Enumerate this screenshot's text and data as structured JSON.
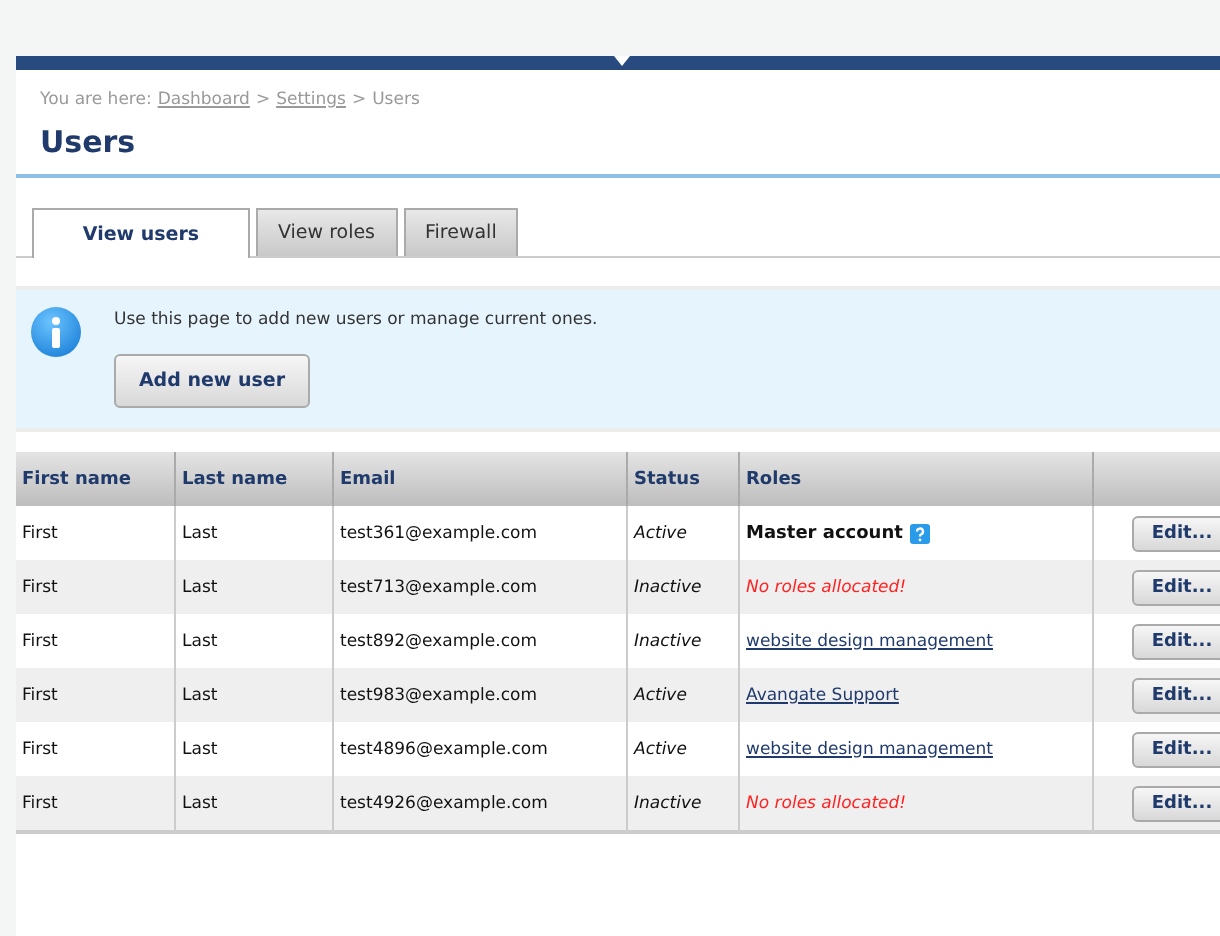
{
  "breadcrumb": {
    "prefix": "You are here:",
    "links": [
      "Dashboard",
      "Settings"
    ],
    "separator": ">",
    "current": "Users"
  },
  "title": "Users",
  "tabs": [
    {
      "label": "View users",
      "selected": true
    },
    {
      "label": "View roles",
      "selected": false
    },
    {
      "label": "Firewall",
      "selected": false
    }
  ],
  "info": {
    "message": "Use this page to add new users or manage current ones.",
    "button": "Add new user"
  },
  "table": {
    "columns": [
      "First name",
      "Last name",
      "Email",
      "Status",
      "Roles"
    ],
    "rows": [
      {
        "first": "First",
        "last": "Last",
        "email": "test361@example.com",
        "status": "Active",
        "role": {
          "kind": "master",
          "text": "Master account"
        },
        "action": "Edit..."
      },
      {
        "first": "First",
        "last": "Last",
        "email": "test713@example.com",
        "status": "Inactive",
        "role": {
          "kind": "none",
          "text": "No roles allocated!"
        },
        "action": "Edit..."
      },
      {
        "first": "First",
        "last": "Last",
        "email": "test892@example.com",
        "status": "Inactive",
        "role": {
          "kind": "link",
          "text": "website design management"
        },
        "action": "Edit..."
      },
      {
        "first": "First",
        "last": "Last",
        "email": "test983@example.com",
        "status": "Active",
        "role": {
          "kind": "link",
          "text": "Avangate Support"
        },
        "action": "Edit..."
      },
      {
        "first": "First",
        "last": "Last",
        "email": "test4896@example.com",
        "status": "Active",
        "role": {
          "kind": "link",
          "text": "website design management"
        },
        "action": "Edit..."
      },
      {
        "first": "First",
        "last": "Last",
        "email": "test4926@example.com",
        "status": "Inactive",
        "role": {
          "kind": "none",
          "text": "No roles allocated!"
        },
        "action": "Edit..."
      }
    ]
  }
}
